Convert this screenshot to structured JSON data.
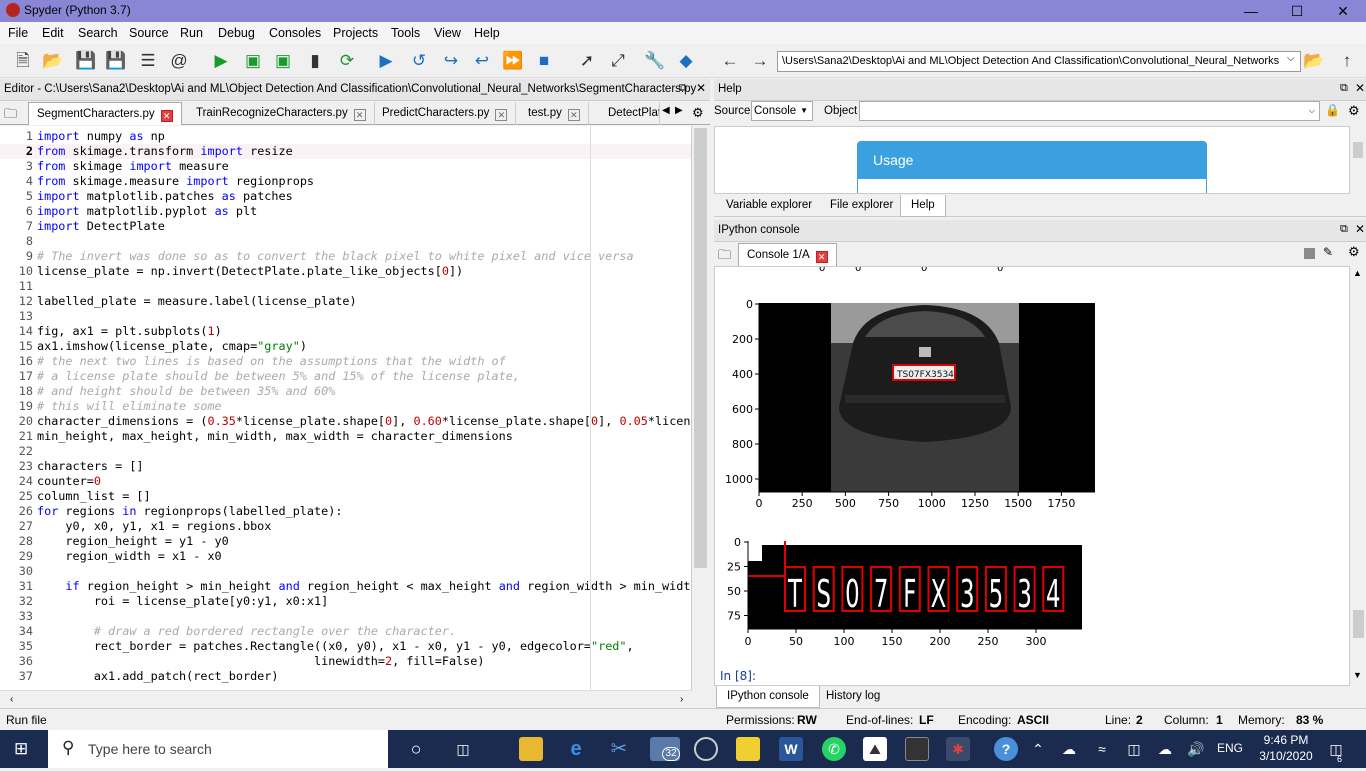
{
  "window": {
    "title": "Spyder (Python 3.7)"
  },
  "menu": [
    "File",
    "Edit",
    "Search",
    "Source",
    "Run",
    "Debug",
    "Consoles",
    "Projects",
    "Tools",
    "View",
    "Help"
  ],
  "toolbar": {
    "path": "\\Users\\Sana2\\Desktop\\Ai and ML\\Object Detection And Classification\\Convolutional_Neural_Networks"
  },
  "editor": {
    "header": "Editor - C:\\Users\\Sana2\\Desktop\\Ai and ML\\Object Detection And Classification\\Convolutional_Neural_Networks\\SegmentCharacters.py",
    "tabs": [
      "SegmentCharacters.py",
      "TrainRecognizeCharacters.py",
      "PredictCharacters.py",
      "test.py",
      "DetectPlat"
    ],
    "lines": [
      "import numpy as np",
      "from skimage.transform import resize",
      "from skimage import measure",
      "from skimage.measure import regionprops",
      "import matplotlib.patches as patches",
      "import matplotlib.pyplot as plt",
      "import DetectPlate",
      "",
      "# The invert was done so as to convert the black pixel to white pixel and vice versa",
      "license_plate = np.invert(DetectPlate.plate_like_objects[0])",
      "",
      "labelled_plate = measure.label(license_plate)",
      "",
      "fig, ax1 = plt.subplots(1)",
      "ax1.imshow(license_plate, cmap=\"gray\")",
      "# the next two lines is based on the assumptions that the width of",
      "# a license plate should be between 5% and 15% of the license plate,",
      "# and height should be between 35% and 60%",
      "# this will eliminate some",
      "character_dimensions = (0.35*license_plate.shape[0], 0.60*license_plate.shape[0], 0.05*licen",
      "min_height, max_height, min_width, max_width = character_dimensions",
      "",
      "characters = []",
      "counter=0",
      "column_list = []",
      "for regions in regionprops(labelled_plate):",
      "    y0, x0, y1, x1 = regions.bbox",
      "    region_height = y1 - y0",
      "    region_width = x1 - x0",
      "",
      "    if region_height > min_height and region_height < max_height and region_width > min_widt",
      "        roi = license_plate[y0:y1, x0:x1]",
      "",
      "        # draw a red bordered rectangle over the character.",
      "        rect_border = patches.Rectangle((x0, y0), x1 - x0, y1 - y0, edgecolor=\"red\",",
      "                                       linewidth=2, fill=False)",
      "        ax1.add_patch(rect_border)"
    ],
    "current_line": 2
  },
  "help": {
    "header": "Help",
    "source_label": "Source",
    "source_value": "Console",
    "object_label": "Object",
    "usage_title": "Usage",
    "tabs": [
      "Variable explorer",
      "File explorer",
      "Help"
    ]
  },
  "console": {
    "header": "IPython console",
    "tab": "Console 1/A",
    "prompt": "In [8]:",
    "bottom_tabs": [
      "IPython console",
      "History log"
    ],
    "plot1": {
      "xticks": [
        "0",
        "250",
        "500",
        "750",
        "1000",
        "1250",
        "1500",
        "1750"
      ],
      "yticks": [
        "0",
        "200",
        "400",
        "600",
        "800",
        "1000"
      ],
      "plate_text": "TS07FX3534"
    },
    "plot2": {
      "xticks": [
        "0",
        "50",
        "100",
        "150",
        "200",
        "250",
        "300"
      ],
      "yticks": [
        "0",
        "25",
        "50",
        "75"
      ],
      "chars": [
        "T",
        "S",
        "0",
        "7",
        "F",
        "X",
        "3",
        "5",
        "3",
        "4"
      ]
    }
  },
  "status": {
    "left": "Run file",
    "permissions_label": "Permissions:",
    "permissions": "RW",
    "eol_label": "End-of-lines:",
    "eol": "LF",
    "encoding_label": "Encoding:",
    "encoding": "ASCII",
    "line_label": "Line:",
    "line": "2",
    "column_label": "Column:",
    "column": "1",
    "memory_label": "Memory:",
    "memory": "83 %"
  },
  "taskbar": {
    "search_placeholder": "Type here to search",
    "time": "9:46 PM",
    "date": "3/10/2020",
    "lang": "ENG",
    "badge_count": "32",
    "notif": "6"
  }
}
